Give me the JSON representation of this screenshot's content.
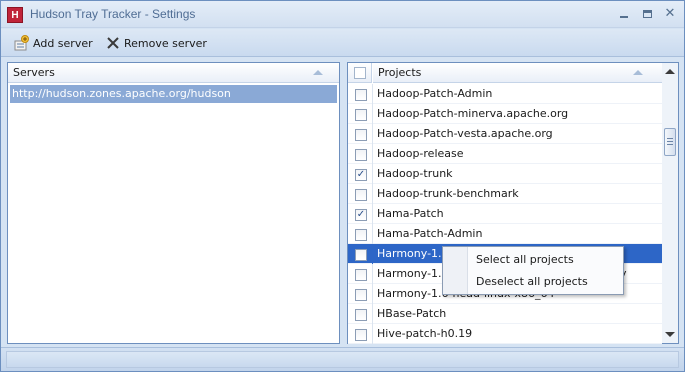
{
  "window": {
    "title": "Hudson Tray Tracker - Settings",
    "app_icon_letter": "H"
  },
  "toolbar": {
    "add_server_label": "Add server",
    "remove_server_label": "Remove server"
  },
  "servers": {
    "header": "Servers",
    "items": [
      {
        "url": "http://hudson.zones.apache.org/hudson",
        "selected": true
      }
    ]
  },
  "projects": {
    "header": "Projects",
    "items": [
      {
        "name": "Hadoop-Patch-Admin",
        "checked": false
      },
      {
        "name": "Hadoop-Patch-minerva.apache.org",
        "checked": false
      },
      {
        "name": "Hadoop-Patch-vesta.apache.org",
        "checked": false
      },
      {
        "name": "Hadoop-release",
        "checked": false
      },
      {
        "name": "Hadoop-trunk",
        "checked": true
      },
      {
        "name": "Hadoop-trunk-benchmark",
        "checked": false
      },
      {
        "name": "Hama-Patch",
        "checked": true
      },
      {
        "name": "Hama-Patch-Admin",
        "checked": false
      },
      {
        "name": "Harmony-1.5",
        "checked": false,
        "selected": true
      },
      {
        "name": "Harmony-1.5",
        "checked": false,
        "suffix": "y"
      },
      {
        "name": "Harmony-1.6-head-linux-x86_64",
        "checked": false
      },
      {
        "name": "HBase-Patch",
        "checked": false
      },
      {
        "name": "Hive-patch-h0.19",
        "checked": false
      }
    ]
  },
  "context_menu": {
    "select_all_label": "Select all projects",
    "deselect_all_label": "Deselect all projects"
  },
  "colors": {
    "selection": "#2d66c7",
    "server_selection": "#8aa9d6",
    "frame": "#d5e3f3"
  }
}
